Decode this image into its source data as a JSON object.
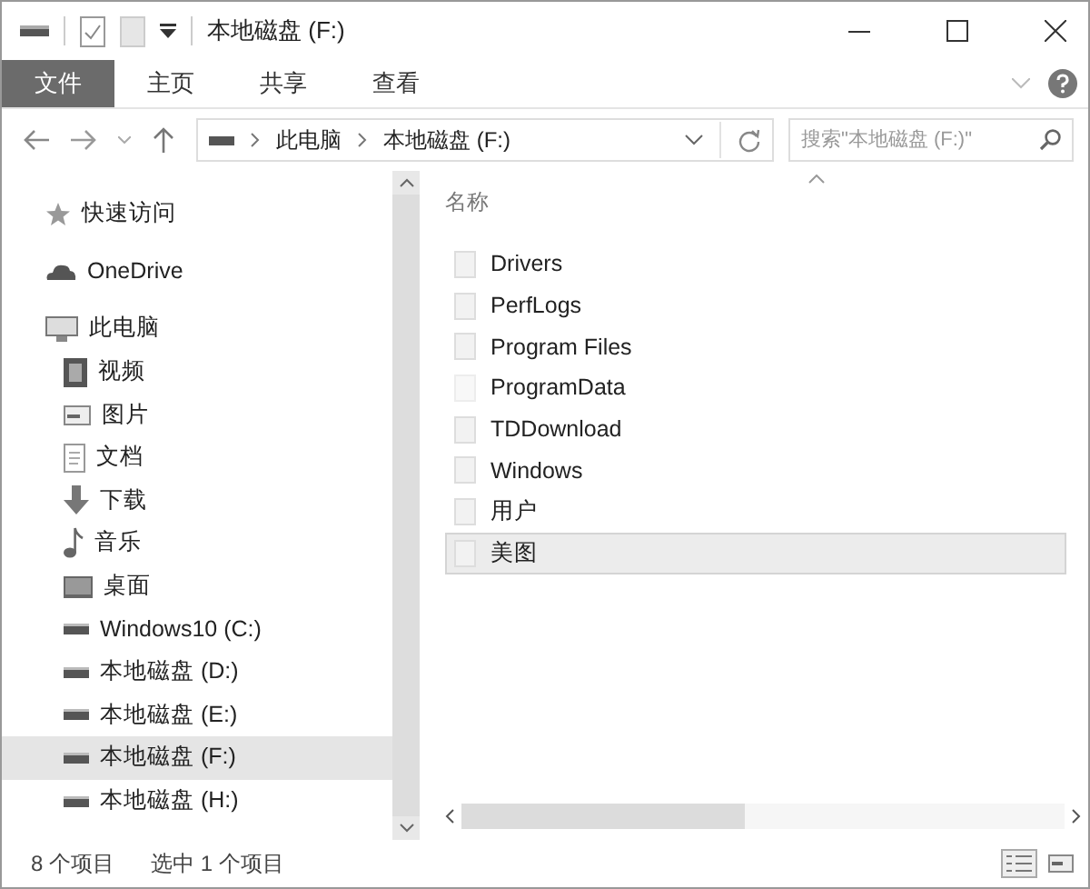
{
  "window": {
    "title": "本地磁盘 (F:)"
  },
  "ribbon_tabs": [
    {
      "label": "文件",
      "selected": true
    },
    {
      "label": "主页",
      "selected": false
    },
    {
      "label": "共享",
      "selected": false
    },
    {
      "label": "查看",
      "selected": false
    }
  ],
  "address": {
    "path": [
      "此电脑",
      "本地磁盘 (F:)"
    ],
    "search_placeholder": "搜索\"本地磁盘 (F:)\""
  },
  "sidebar": {
    "items": [
      {
        "label": "快速访问",
        "kind": "star",
        "selected": false
      },
      {
        "label": "OneDrive",
        "kind": "cloud",
        "selected": false
      },
      {
        "label": "此电脑",
        "kind": "pc",
        "selected": false,
        "children": [
          {
            "label": "视频",
            "kind": "video",
            "selected": false
          },
          {
            "label": "图片",
            "kind": "picture",
            "selected": false
          },
          {
            "label": "文档",
            "kind": "document",
            "selected": false
          },
          {
            "label": "下载",
            "kind": "download",
            "selected": false
          },
          {
            "label": "音乐",
            "kind": "music",
            "selected": false
          },
          {
            "label": "桌面",
            "kind": "desktop",
            "selected": false
          },
          {
            "label": "Windows10 (C:)",
            "kind": "drive",
            "selected": false
          },
          {
            "label": "本地磁盘 (D:)",
            "kind": "drive",
            "selected": false
          },
          {
            "label": "本地磁盘 (E:)",
            "kind": "drive",
            "selected": false
          },
          {
            "label": "本地磁盘 (F:)",
            "kind": "drive",
            "selected": true
          },
          {
            "label": "本地磁盘 (H:)",
            "kind": "drive",
            "selected": false
          }
        ]
      }
    ]
  },
  "file_list": {
    "column": "名称",
    "rows": [
      {
        "name": "Drivers",
        "hidden": false,
        "selected": false
      },
      {
        "name": "PerfLogs",
        "hidden": false,
        "selected": false
      },
      {
        "name": "Program Files",
        "hidden": false,
        "selected": false
      },
      {
        "name": "ProgramData",
        "hidden": true,
        "selected": false
      },
      {
        "name": "TDDownload",
        "hidden": false,
        "selected": false
      },
      {
        "name": "Windows",
        "hidden": false,
        "selected": false
      },
      {
        "name": "用户",
        "hidden": false,
        "selected": false
      },
      {
        "name": "美图",
        "hidden": false,
        "selected": true
      }
    ]
  },
  "status_bar": {
    "item_count": "8 个项目",
    "selection": "选中 1 个项目"
  }
}
